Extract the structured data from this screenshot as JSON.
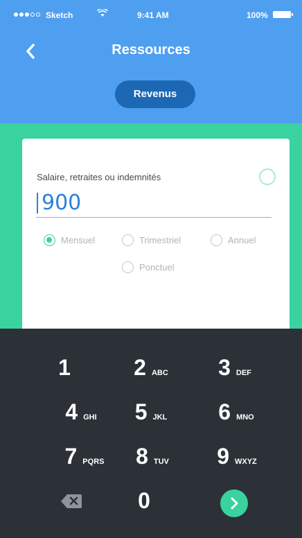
{
  "status_bar": {
    "carrier": "Sketch",
    "time": "9:41 AM",
    "battery": "100%"
  },
  "nav": {
    "title": "Ressources",
    "back_icon": "chevron-left-icon"
  },
  "segment": {
    "label": "Revenus"
  },
  "form": {
    "field_label": "Salaire, retraites ou indemnités",
    "amount_value": "900",
    "frequency_options": [
      {
        "label": "Mensuel",
        "selected": true
      },
      {
        "label": "Trimestriel",
        "selected": false
      },
      {
        "label": "Annuel",
        "selected": false
      },
      {
        "label": "Ponctuel",
        "selected": false
      }
    ]
  },
  "keypad": {
    "keys": [
      {
        "digit": "1",
        "letters": ""
      },
      {
        "digit": "2",
        "letters": "ABC"
      },
      {
        "digit": "3",
        "letters": "DEF"
      },
      {
        "digit": "4",
        "letters": "GHI"
      },
      {
        "digit": "5",
        "letters": "JKL"
      },
      {
        "digit": "6",
        "letters": "MNO"
      },
      {
        "digit": "7",
        "letters": "PQRS"
      },
      {
        "digit": "8",
        "letters": "TUV"
      },
      {
        "digit": "9",
        "letters": "WXYZ"
      },
      {
        "digit": "0",
        "letters": ""
      }
    ],
    "delete_icon": "backspace-icon",
    "next_icon": "chevron-right-icon"
  },
  "colors": {
    "header_blue": "#4f9ff0",
    "pill_blue": "#1c68b5",
    "accent_green": "#3ad29f",
    "keypad_dark": "#2c3137",
    "amount_blue": "#2a80dd"
  }
}
